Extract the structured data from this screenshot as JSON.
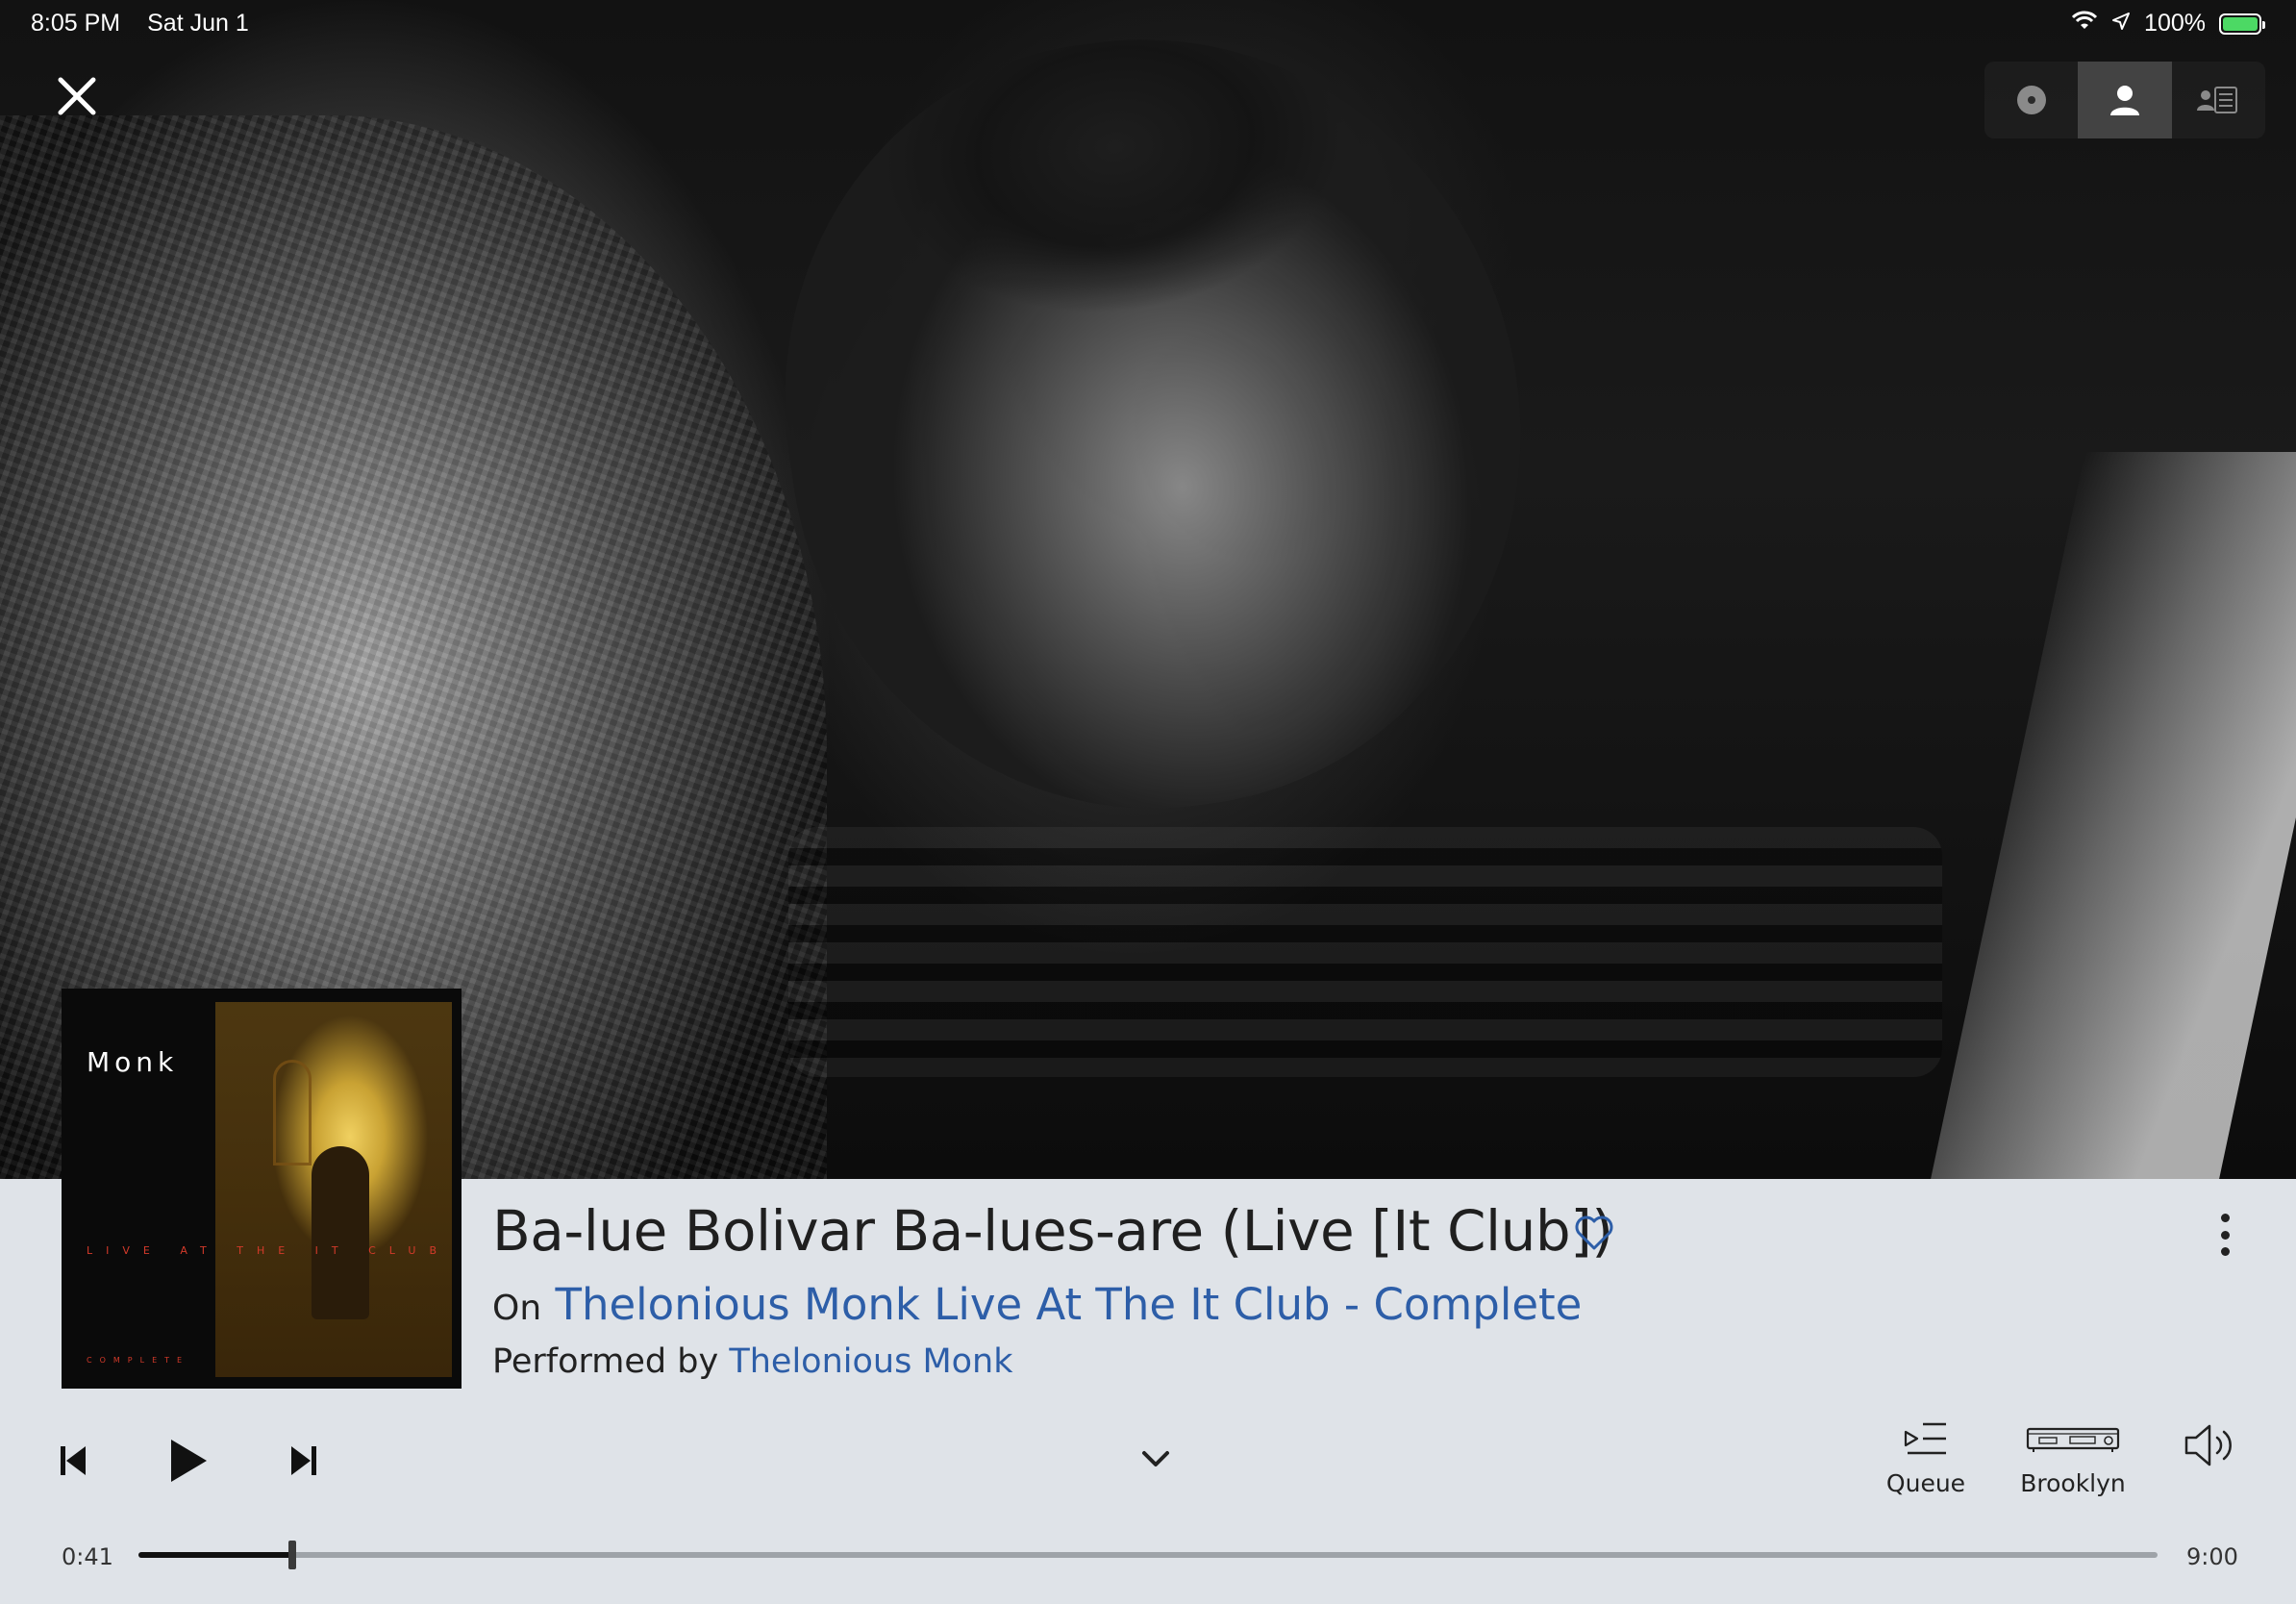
{
  "status_bar": {
    "time": "8:05 PM",
    "date": "Sat Jun 1",
    "battery_text": "100%",
    "battery_level": 1.0,
    "battery_color": "#4cd964",
    "icons": [
      "wifi-icon",
      "location-arrow-icon",
      "battery-charging-icon"
    ]
  },
  "top_controls": {
    "close_icon": "close-icon",
    "view_segments": [
      {
        "icon": "album-disc-icon",
        "active": false
      },
      {
        "icon": "artist-person-icon",
        "active": true
      },
      {
        "icon": "artist-bio-icon",
        "active": false
      }
    ]
  },
  "album_art": {
    "artist_text": "Monk",
    "subtitle_text": "LIVE AT THE IT CLUB",
    "footer_text": "COMPLETE"
  },
  "track": {
    "title": "Ba-lue Bolivar Ba-lues-are (Live [It Club])",
    "on_prefix": "On",
    "album": "Thelonious Monk Live At The It Club - Complete",
    "performed_prefix": "Performed by",
    "artist": "Thelonious Monk",
    "favorite_icon": "heart-outline-icon",
    "more_icon": "more-vertical-icon"
  },
  "transport": {
    "prev_icon": "skip-previous-icon",
    "play_icon": "play-icon",
    "next_icon": "skip-next-icon",
    "collapse_icon": "chevron-down-icon"
  },
  "actions": {
    "queue_label": "Queue",
    "queue_icon": "queue-icon",
    "zone_label": "Brooklyn",
    "zone_icon": "audio-device-icon",
    "volume_icon": "volume-icon"
  },
  "progress": {
    "elapsed": "0:41",
    "total": "9:00",
    "fraction": 0.076
  },
  "colors": {
    "panel_bg": "#dfe3e8",
    "link": "#2d5ea8",
    "text": "#1f1f1f"
  }
}
